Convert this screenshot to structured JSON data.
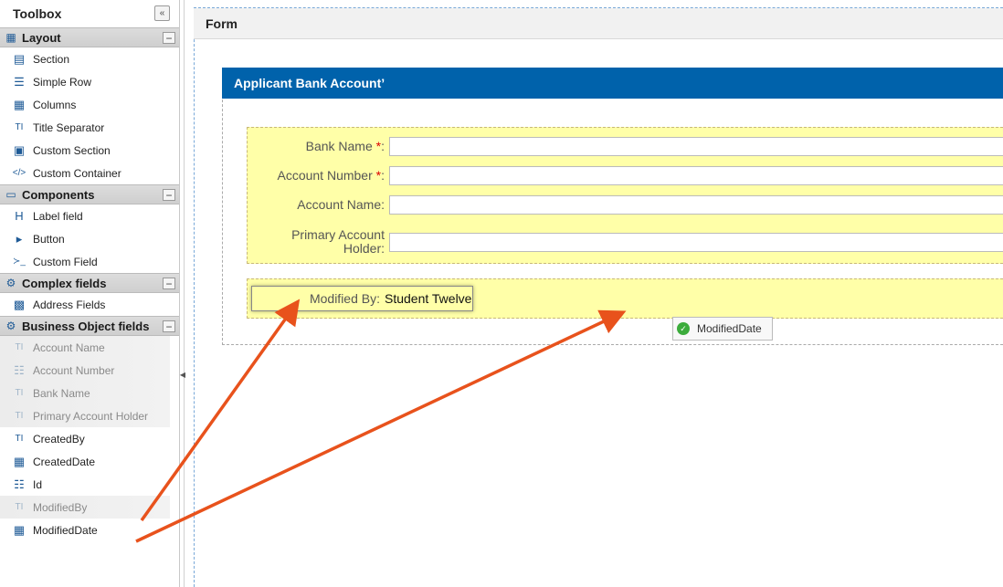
{
  "toolbox": {
    "title": "Toolbox",
    "collapse_glyph": "«",
    "groups": [
      {
        "label": "Layout",
        "icon": "table-icon",
        "items": [
          {
            "label": "Section",
            "icon": "section-icon"
          },
          {
            "label": "Simple Row",
            "icon": "rows-icon"
          },
          {
            "label": "Columns",
            "icon": "columns-icon"
          },
          {
            "label": "Title Separator",
            "icon": "title-icon"
          },
          {
            "label": "Custom Section",
            "icon": "custom-section-icon"
          },
          {
            "label": "Custom Container",
            "icon": "code-icon"
          }
        ]
      },
      {
        "label": "Components",
        "icon": "monitor-icon",
        "items": [
          {
            "label": "Label field",
            "icon": "heading-icon"
          },
          {
            "label": "Button",
            "icon": "caret-right-icon"
          },
          {
            "label": "Custom Field",
            "icon": "terminal-icon"
          }
        ]
      },
      {
        "label": "Complex fields",
        "icon": "gear-icon",
        "items": [
          {
            "label": "Address Fields",
            "icon": "address-card-icon"
          }
        ]
      },
      {
        "label": "Business Object fields",
        "icon": "gear-icon",
        "items": [
          {
            "label": "Account Name",
            "icon": "text-icon",
            "disabled": true
          },
          {
            "label": "Account Number",
            "icon": "list-icon",
            "disabled": true
          },
          {
            "label": "Bank Name",
            "icon": "text-icon",
            "disabled": true
          },
          {
            "label": "Primary Account Holder",
            "icon": "text-icon",
            "disabled": true
          },
          {
            "label": "CreatedBy",
            "icon": "text-icon"
          },
          {
            "label": "CreatedDate",
            "icon": "calendar-icon"
          },
          {
            "label": "Id",
            "icon": "list-icon"
          },
          {
            "label": "ModifiedBy",
            "icon": "text-icon",
            "disabled": true
          },
          {
            "label": "ModifiedDate",
            "icon": "calendar-icon"
          }
        ]
      }
    ]
  },
  "form": {
    "title": "Form",
    "section_title": "Applicant Bank Account’",
    "fields": [
      {
        "label": "Bank Name",
        "required": true
      },
      {
        "label": "Account Number",
        "required": true
      },
      {
        "label": "Account Name:",
        "required": false
      },
      {
        "label": "Primary Account Holder:",
        "required": false
      }
    ],
    "required_marker": "*",
    "required_suffix": ":",
    "modified_by": {
      "label": "Modified By:",
      "value": "Student Twelve"
    },
    "drag_token": {
      "label": "ModifiedDate",
      "icon": "check-circle-icon"
    }
  },
  "colors": {
    "section_bar": "#0062ab",
    "field_bg": "#ffffa8",
    "required": "#dd0000",
    "annotation_arrow": "#e8521c"
  }
}
